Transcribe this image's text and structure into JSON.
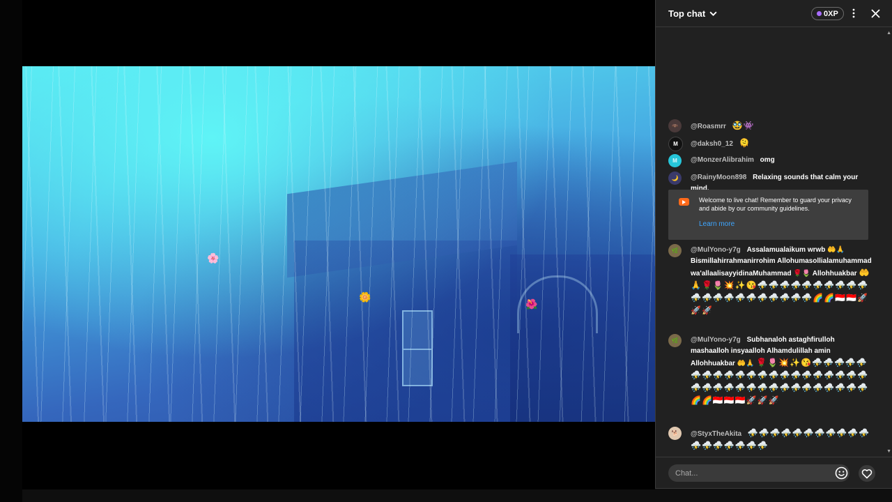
{
  "chat": {
    "title": "Top chat",
    "xp_badge": "0XP",
    "input_placeholder": "Chat...",
    "messages": [
      {
        "author": "@Roasmrr",
        "text": "",
        "emojis": "🥸👾",
        "avatar_color": "#4a3a3a"
      },
      {
        "author": "@daksh0_12",
        "text": "",
        "emojis": "🫠",
        "avatar_color": "#111111"
      },
      {
        "author": "@MonzerAlibrahim",
        "text": "omg",
        "emojis": "",
        "avatar_color": "#26c6da"
      },
      {
        "author": "@RainyMoon898",
        "text": "Relaxing sounds that calm your mind.",
        "emojis": "",
        "avatar_color": "#3a3a6a"
      },
      {
        "author": "@MulYono-y7g",
        "text": "Assalamualaikum wrwb 🤲🙏 Bismillahirrahmanirrohim Allohumasollialamuhammad wa'allaalisayyidinaMuhammad 🌹🌷 Allohhuakbar",
        "emojis": "🤲🙏🌹🌷💥✨😘⛈️⛈️⛈️⛈️⛈️⛈️⛈️⛈️⛈️⛈️⛈️⛈️⛈️⛈️⛈️⛈️⛈️⛈️⛈️⛈️⛈️🌈🌈🇮🇩🇮🇩🚀🚀🚀",
        "avatar_color": "#7b6a4a"
      },
      {
        "author": "@MulYono-y7g",
        "text": "Subhanaloh astaghfirulloh mashaalloh insyaalloh Alhamdulillah amin Allohhuakbar 🤲🙏",
        "emojis": "🌹🌷💥✨😘⛈️⛈️⛈️⛈️⛈️⛈️⛈️⛈️⛈️⛈️⛈️⛈️⛈️⛈️⛈️⛈️⛈️⛈️⛈️⛈️⛈️⛈️⛈️⛈️⛈️⛈️⛈️⛈️⛈️⛈️⛈️⛈️⛈️⛈️⛈️⛈️⛈️🌈🌈🇮🇩🇮🇩🇮🇩🚀🚀🚀",
        "avatar_color": "#7b6a4a"
      },
      {
        "author": "@StyxTheAkita",
        "text": "",
        "emojis": "⛈️⛈️⛈️⛈️⛈️⛈️⛈️⛈️⛈️⛈️⛈️⛈️⛈️⛈️⛈️⛈️⛈️⛈️",
        "avatar_color": "#e0c8b0"
      }
    ],
    "welcome": {
      "text": "Welcome to live chat! Remember to guard your privacy and abide by our community guidelines.",
      "link": "Learn more"
    }
  },
  "icons": {
    "chevron": "chevron-down-icon",
    "more": "more-vertical-icon",
    "close": "close-icon",
    "emoji": "smiley-icon",
    "heart": "heart-icon",
    "welcome": "youtube-icon"
  },
  "colors": {
    "panel_bg": "#212121",
    "link": "#3ea6ff",
    "xp_dot": "#a86cff",
    "welcome_icon": "#ff6a1a"
  }
}
